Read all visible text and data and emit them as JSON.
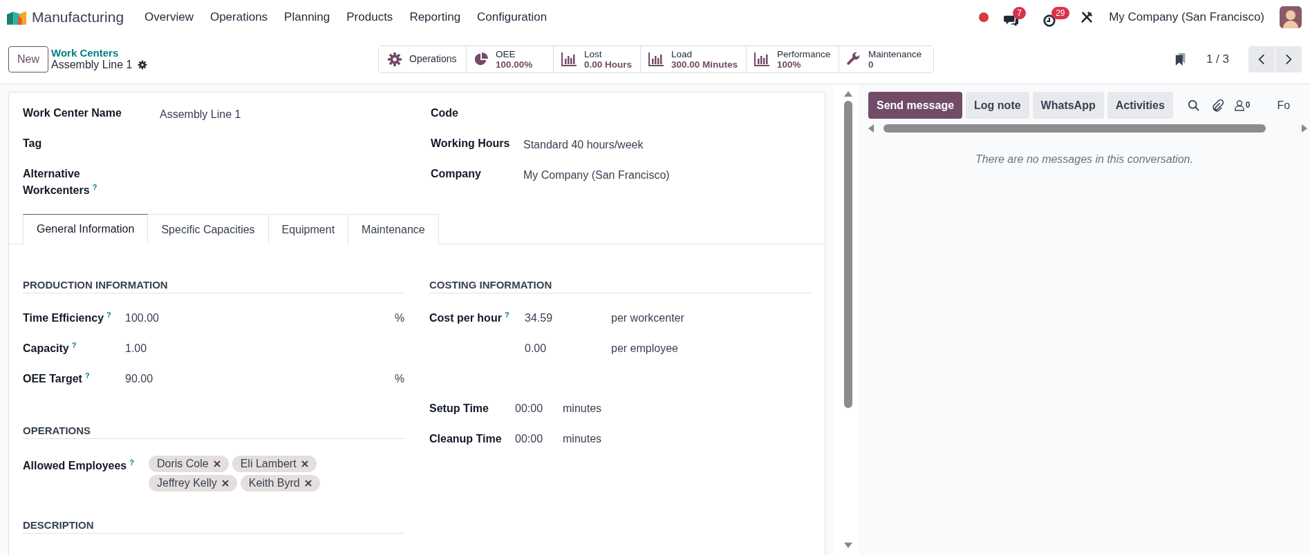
{
  "navbar": {
    "app_name": "Manufacturing",
    "menu": [
      "Overview",
      "Operations",
      "Planning",
      "Products",
      "Reporting",
      "Configuration"
    ],
    "chat_count": "7",
    "activity_count": "29",
    "company": "My Company (San Francisco)"
  },
  "control_panel": {
    "new_button": "New",
    "breadcrumb": "Work Centers",
    "record_name": "Assembly Line 1",
    "smart_buttons": [
      {
        "kind": "gear",
        "label": "Operations"
      },
      {
        "kind": "pie",
        "label": "OEE",
        "value": "100.00%"
      },
      {
        "kind": "bars",
        "label": "Lost",
        "value": "0.00 Hours"
      },
      {
        "kind": "bars",
        "label": "Load",
        "value": "300.00 Minutes"
      },
      {
        "kind": "bars",
        "label": "Performance",
        "value": "100%"
      },
      {
        "kind": "wrench",
        "label": "Maintenance",
        "value": "0"
      }
    ],
    "pager": "1 / 3"
  },
  "form": {
    "left_fields": [
      {
        "label": "Work Center Name",
        "value": "Assembly Line 1"
      },
      {
        "label": "Tag"
      },
      {
        "label": "Alternative Workcenters",
        "help": "?"
      }
    ],
    "right_fields": [
      {
        "label": "Code"
      },
      {
        "label": "Working Hours",
        "value": "Standard 40 hours/week"
      },
      {
        "label": "Company",
        "value": "My Company (San Francisco)"
      }
    ],
    "tabs": [
      {
        "label": "General Information",
        "selected": true
      },
      {
        "label": "Specific Capacities",
        "selected": false
      },
      {
        "label": "Equipment",
        "selected": false
      },
      {
        "label": "Maintenance",
        "selected": false
      }
    ],
    "production": {
      "title": "PRODUCTION INFORMATION",
      "rows": [
        {
          "label": "Time Efficiency",
          "help": "?",
          "value": "100.00",
          "unit": "%"
        },
        {
          "label": "Capacity",
          "help": "?",
          "value": "1.00"
        },
        {
          "label": "OEE Target",
          "help": "?",
          "value": "90.00",
          "unit": "%"
        }
      ]
    },
    "costing": {
      "title": "COSTING INFORMATION",
      "cost_rows": [
        {
          "label": "Cost per hour",
          "help": "?",
          "value": "34.59",
          "unit": "per workcenter"
        },
        {
          "value": "0.00",
          "unit": "per employee"
        }
      ],
      "time_rows": [
        {
          "label": "Setup Time",
          "value": "00:00",
          "unit": "minutes"
        },
        {
          "label": "Cleanup Time",
          "value": "00:00",
          "unit": "minutes"
        }
      ]
    },
    "operations": {
      "title": "OPERATIONS",
      "label": "Allowed Employees",
      "help": "?",
      "employees": [
        "Doris Cole",
        "Eli Lambert",
        "Jeffrey Kelly",
        "Keith Byrd"
      ]
    },
    "description_title": "DESCRIPTION"
  },
  "chatter": {
    "buttons": [
      {
        "label": "Send message",
        "selected": true
      },
      {
        "label": "Log note",
        "selected": false
      },
      {
        "label": "WhatsApp",
        "selected": false
      },
      {
        "label": "Activities",
        "selected": false
      }
    ],
    "followers_count": "0",
    "follow_label": "Fo",
    "empty_text": "There are no messages in this conversation."
  }
}
